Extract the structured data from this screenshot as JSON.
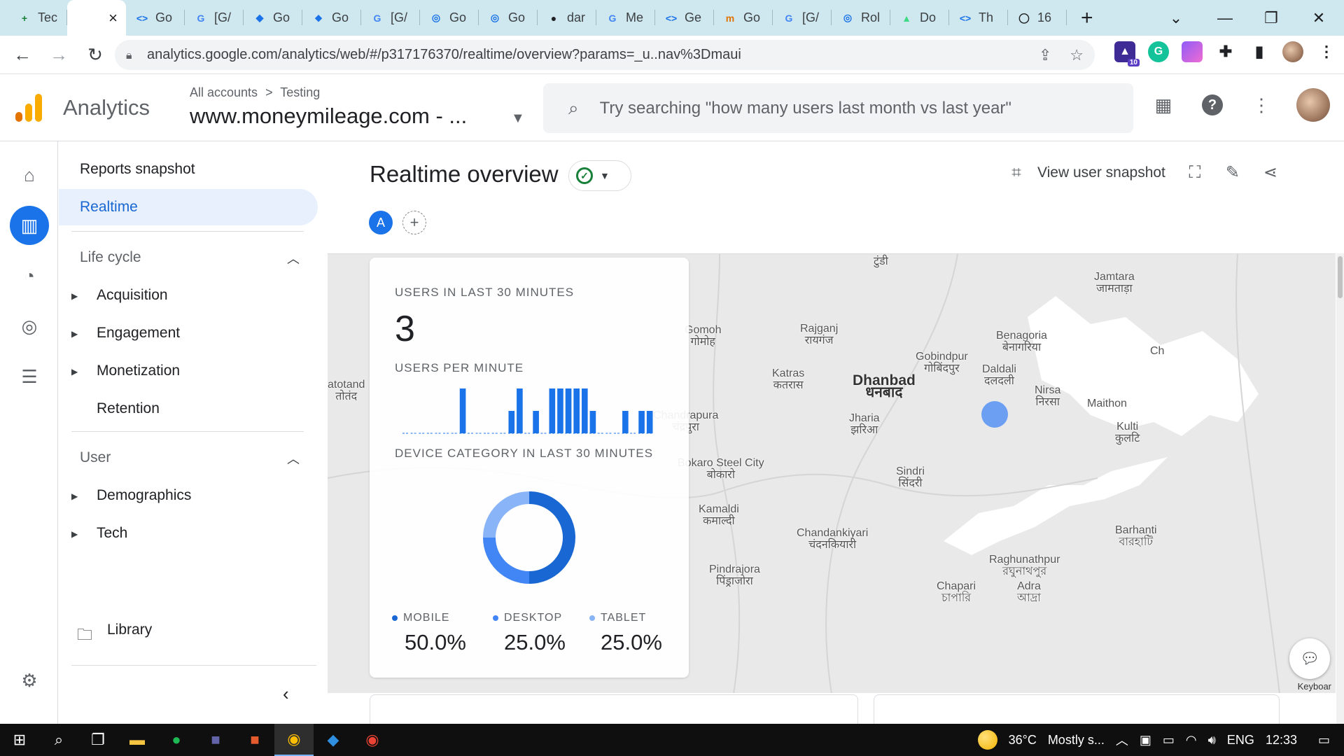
{
  "tabs": [
    {
      "label": "Tec",
      "icon": "sheets-icon",
      "color": "#188038",
      "glyph": "+"
    },
    {
      "label": "",
      "icon": "analytics-icon",
      "color": "#f9ab00",
      "glyph": "",
      "active": true
    },
    {
      "label": "Go",
      "icon": "code-icon",
      "color": "#1a73e8",
      "glyph": "<>"
    },
    {
      "label": "[G/",
      "icon": "google-icon",
      "color": "#4285f4",
      "glyph": "G"
    },
    {
      "label": "Go",
      "icon": "ads-icon",
      "color": "#1a73e8",
      "glyph": "◆"
    },
    {
      "label": "Go",
      "icon": "tag-icon",
      "color": "#1a73e8",
      "glyph": "⬥"
    },
    {
      "label": "[G/",
      "icon": "google-icon",
      "color": "#4285f4",
      "glyph": "G"
    },
    {
      "label": "Go",
      "icon": "target-icon",
      "color": "#1a73e8",
      "glyph": "◎"
    },
    {
      "label": "Go",
      "icon": "target-icon",
      "color": "#1a73e8",
      "glyph": "◎"
    },
    {
      "label": "dar",
      "icon": "github-icon",
      "color": "#202124",
      "glyph": "●"
    },
    {
      "label": "Me",
      "icon": "google-icon",
      "color": "#4285f4",
      "glyph": "G"
    },
    {
      "label": "Ge",
      "icon": "code-icon",
      "color": "#1a73e8",
      "glyph": "<>"
    },
    {
      "label": "Go",
      "icon": "m-icon",
      "color": "#e37400",
      "glyph": "m"
    },
    {
      "label": "[G/",
      "icon": "google-icon",
      "color": "#4285f4",
      "glyph": "G"
    },
    {
      "label": "Rol",
      "icon": "target-icon",
      "color": "#1a73e8",
      "glyph": "◎"
    },
    {
      "label": "Do",
      "icon": "android-icon",
      "color": "#3ddc84",
      "glyph": "▲"
    },
    {
      "label": "Th",
      "icon": "code-icon",
      "color": "#1a73e8",
      "glyph": "<>"
    },
    {
      "label": "16",
      "icon": "whatsapp-icon",
      "color": "#202124",
      "glyph": "◯"
    }
  ],
  "browser": {
    "url": "analytics.google.com/analytics/web/#/p317176370/realtime/overview?params=_u..nav%3Dmaui",
    "extension_badge": "10"
  },
  "header": {
    "app_title": "Analytics",
    "breadcrumb_all": "All accounts",
    "breadcrumb_sep": ">",
    "breadcrumb_account": "Testing",
    "property": "www.moneymileage.com - ...",
    "search_placeholder": "Try searching \"how many users last month vs last year\""
  },
  "sidenav": {
    "reports_snapshot": "Reports snapshot",
    "realtime": "Realtime",
    "lifecycle": "Life cycle",
    "lifecycle_items": [
      "Acquisition",
      "Engagement",
      "Monetization",
      "Retention"
    ],
    "user": "User",
    "user_items": [
      "Demographics",
      "Tech"
    ],
    "library": "Library"
  },
  "main": {
    "title": "Realtime overview",
    "view_snapshot": "View user snapshot",
    "comparison_letter": "A"
  },
  "card": {
    "users_label": "USERS IN LAST 30 MINUTES",
    "users_value": "3",
    "per_minute_label": "USERS PER MINUTE",
    "device_label": "DEVICE CATEGORY IN LAST 30 MINUTES",
    "per_minute_values": [
      0,
      0,
      0,
      0,
      0,
      0,
      0,
      1,
      0,
      0,
      0,
      0,
      0,
      0.5,
      1,
      0,
      0.5,
      0,
      1,
      1,
      1,
      1,
      1,
      0.5,
      0,
      0,
      0,
      0.5,
      0,
      0.5,
      0.5
    ],
    "devices": [
      {
        "name": "MOBILE",
        "value": "50.0%",
        "share": 0.5,
        "color": "#1967d2"
      },
      {
        "name": "DESKTOP",
        "value": "25.0%",
        "share": 0.25,
        "color": "#4285f4"
      },
      {
        "name": "TABLET",
        "value": "25.0%",
        "share": 0.25,
        "color": "#8ab4f8"
      }
    ]
  },
  "map": {
    "places": [
      {
        "en": "Jamtara",
        "hi": "जामताड़ा"
      },
      {
        "en": "",
        "hi": "टुंडी"
      },
      {
        "en": "Gomoh",
        "hi": "गोमोह"
      },
      {
        "en": "Rajganj",
        "hi": "रायगंज"
      },
      {
        "en": "Benagoria",
        "hi": "बेनागरिया"
      },
      {
        "en": "Gobindpur",
        "hi": "गोबिंदपुर"
      },
      {
        "en": "Daldali",
        "hi": "दलदली"
      },
      {
        "en": "Katras",
        "hi": "कतरास"
      },
      {
        "en": "Dhanbad",
        "hi": "धनबाद"
      },
      {
        "en": "Nirsa",
        "hi": "निरसा"
      },
      {
        "en": "Maithon",
        "hi": ""
      },
      {
        "en": "Ch",
        "hi": ""
      },
      {
        "en": "atotand",
        "hi": "तोतंद"
      },
      {
        "en": "Chandrapura",
        "hi": "चंद्रपुरा"
      },
      {
        "en": "Jharia",
        "hi": "झरिआ"
      },
      {
        "en": "Kulti",
        "hi": "कुलटि"
      },
      {
        "en": "Bokaro Steel City",
        "hi": "बोकारो"
      },
      {
        "en": "Sindri",
        "hi": "सिंदरी"
      },
      {
        "en": "Kamaldi",
        "hi": "कमाल्दी"
      },
      {
        "en": "Chandankiyari",
        "hi": "चंदनकियारी"
      },
      {
        "en": "Barhanti",
        "hi": "বারহাটি"
      },
      {
        "en": "Raghunathpur",
        "hi": "রঘুনাথপুর"
      },
      {
        "en": "Pindrajora",
        "hi": "पिंड्राजोरा"
      },
      {
        "en": "Chapari",
        "hi": "চাপারি"
      },
      {
        "en": "Adra",
        "hi": "আদ্রা"
      }
    ],
    "keyboard_label": "Keyboar"
  },
  "taskbar": {
    "temperature": "36°C",
    "weather": "Mostly s...",
    "language": "ENG",
    "time": "12:33"
  }
}
